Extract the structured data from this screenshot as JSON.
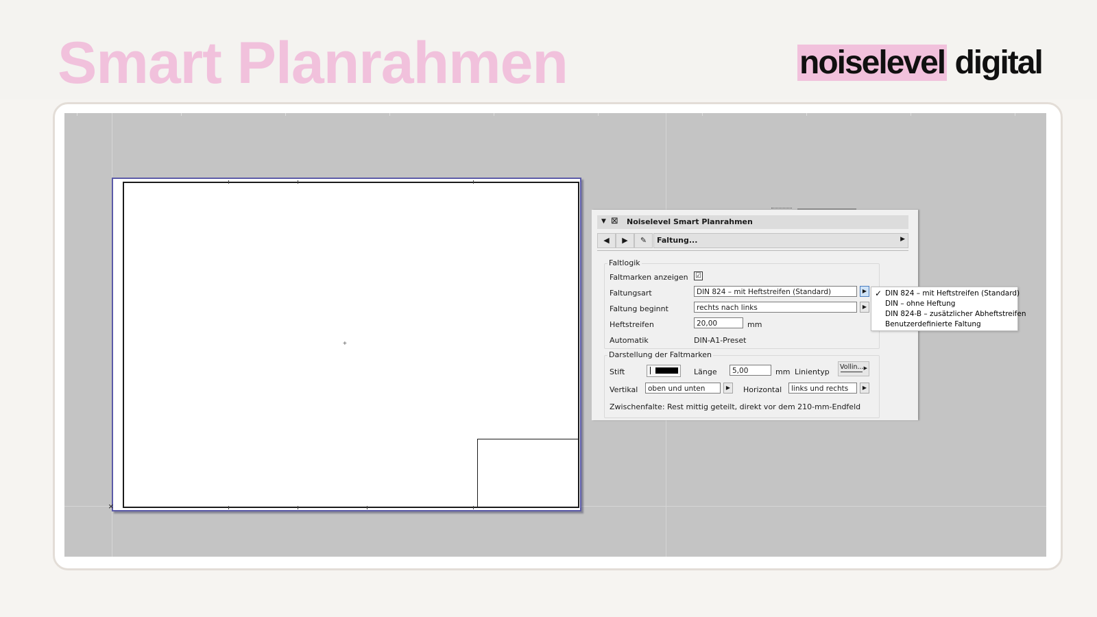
{
  "slide": {
    "title": "Smart Planrahmen",
    "logo_highlight": "noiselevel",
    "logo_rest": "digital",
    "accent_color": "#f1c1dc"
  },
  "panel": {
    "title": "Noiselevel Smart Planrahmen",
    "nav_field": "Faltung...",
    "group_faltlogik": {
      "label": "Faltlogik",
      "faltmarken_label": "Faltmarken anzeigen",
      "faltmarken_checked": "☑",
      "faltungsart_label": "Faltungsart",
      "faltungsart_value": "DIN 824 – mit Heftstreifen (Standard)",
      "faltung_beginnt_label": "Faltung beginnt",
      "faltung_beginnt_value": "rechts nach links",
      "heftstreifen_label": "Heftstreifen",
      "heftstreifen_value": "20,00",
      "heftstreifen_unit": "mm",
      "automatik_label": "Automatik",
      "automatik_value": "DIN-A1-Preset"
    },
    "group_darstellung": {
      "label": "Darstellung der Faltmarken",
      "stift_label": "Stift",
      "laenge_label": "Länge",
      "laenge_value": "5,00",
      "laenge_unit": "mm",
      "linientyp_label": "Linientyp",
      "linientyp_value": "Vollin...",
      "vertikal_label": "Vertikal",
      "vertikal_value": "oben und unten",
      "horizontal_label": "Horizontal",
      "horizontal_value": "links und rechts",
      "note": "Zwischenfalte: Rest mittig geteilt, direkt vor dem 210-mm-Endfeld"
    }
  },
  "dropdown": {
    "items": [
      "DIN 824 – mit Heftstreifen (Standard)",
      "DIN – ohne Heftung",
      "DIN 824-B – zusätzlicher Abheftstreifen",
      "Benutzerdefinierte Faltung"
    ],
    "selected_mark": "✓"
  },
  "icons": {
    "collapse": "triangle-down-icon",
    "prev": "arrow-left-icon",
    "next": "arrow-right-icon",
    "settings": "settings-page-icon",
    "popup": "popup-arrow-icon",
    "check": "checkmark-icon",
    "center": "plus-icon",
    "corner": "cross-icon"
  }
}
